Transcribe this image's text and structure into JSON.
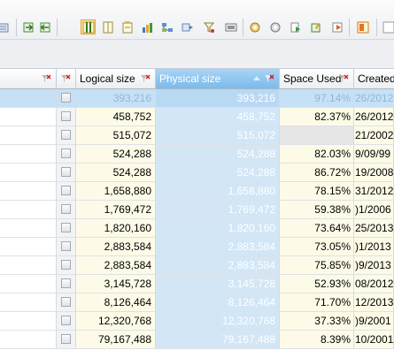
{
  "toolbar": {
    "icons": [
      "list-view-icon",
      "export-icon",
      "import-icon",
      "columns-icon",
      "details-icon",
      "report-icon",
      "chart-icon",
      "tree-icon",
      "filter-icon",
      "drive-icon",
      "settings-icon",
      "gear-icon",
      "copy-icon",
      "refresh-icon",
      "edit-icon",
      "highlight-icon"
    ]
  },
  "columns": {
    "logical": "Logical size",
    "physical": "Physical size",
    "space_used": "Space Used",
    "created": "Created"
  },
  "rows": [
    {
      "logical": "393,216",
      "physical": "393,216",
      "space": "97.14%",
      "created": "26/2012",
      "selected": true
    },
    {
      "logical": "458,752",
      "physical": "458,752",
      "space": "82.37%",
      "created": "26/2012"
    },
    {
      "logical": "515,072",
      "physical": "515,072",
      "space": "",
      "created": "21/2002",
      "unknown": true
    },
    {
      "logical": "524,288",
      "physical": "524,288",
      "space": "82.03%",
      "created": "9/09/99"
    },
    {
      "logical": "524,288",
      "physical": "524,288",
      "space": "86.72%",
      "created": "19/2008"
    },
    {
      "logical": "1,658,880",
      "physical": "1,658,880",
      "space": "78.15%",
      "created": "31/2012"
    },
    {
      "logical": "1,769,472",
      "physical": "1,769,472",
      "space": "59.38%",
      "created": ")1/2006"
    },
    {
      "logical": "1,820,160",
      "physical": "1,820,160",
      "space": "73.64%",
      "created": "25/2013"
    },
    {
      "logical": "2,883,584",
      "physical": "2,883,584",
      "space": "73.05%",
      "created": ")1/2013"
    },
    {
      "logical": "2,883,584",
      "physical": "2,883,584",
      "space": "75.85%",
      "created": ")9/2013"
    },
    {
      "logical": "3,145,728",
      "physical": "3,145,728",
      "space": "52.93%",
      "created": "08/2012"
    },
    {
      "logical": "8,126,464",
      "physical": "8,126,464",
      "space": "71.70%",
      "created": "12/2013"
    },
    {
      "logical": "12,320,768",
      "physical": "12,320,768",
      "space": "37.33%",
      "created": ")9/2001"
    },
    {
      "logical": "79,167,488",
      "physical": "79,167,488",
      "space": "8.39%",
      "created": "10/2001"
    }
  ],
  "help_glyph": "?"
}
